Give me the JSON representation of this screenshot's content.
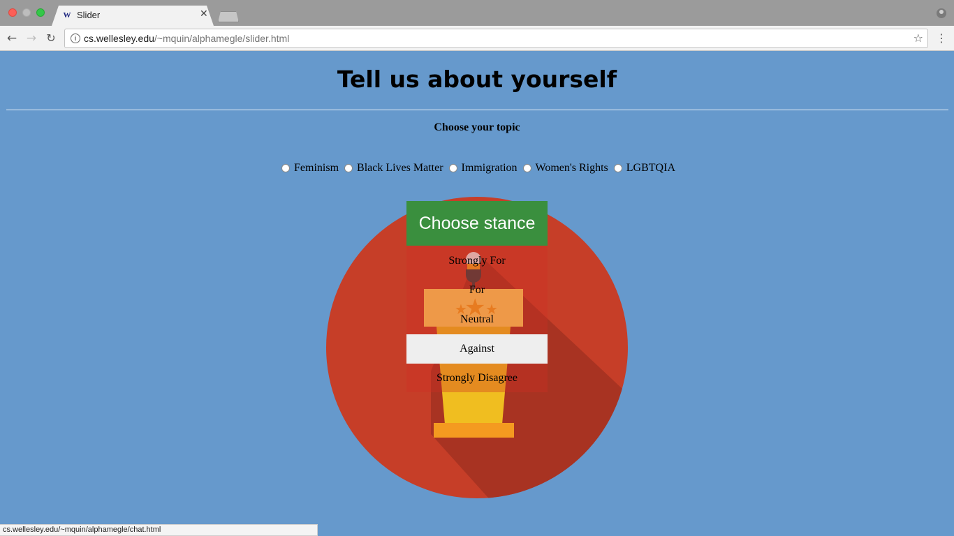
{
  "browser": {
    "tab_title": "Slider",
    "tab_favicon": "W",
    "url_host": "cs.wellesley.edu",
    "url_path": "/~mquin/alphamegle/slider.html",
    "status_url": "cs.wellesley.edu/~mquin/alphamegle/chat.html"
  },
  "page": {
    "title": "Tell us about yourself",
    "subheading": "Choose your topic",
    "topics": [
      "Feminism",
      "Black Lives Matter",
      "Immigration",
      "Women's Rights",
      "LGBTQIA"
    ],
    "stance": {
      "header": "Choose stance",
      "options": [
        "Strongly For",
        "For",
        "Neutral",
        "Against",
        "Strongly Disagree"
      ],
      "highlighted": "Against"
    }
  },
  "colors": {
    "page_bg": "#6699cc",
    "circle": "#c63e28",
    "stance_header": "#3a8f3e",
    "podium": "#f0be20"
  }
}
